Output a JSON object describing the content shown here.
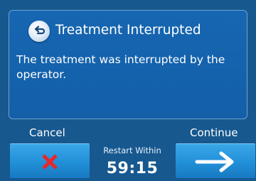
{
  "dialog": {
    "title": "Treatment Interrupted",
    "message": "The treatment was interrupted by the operator.",
    "back_icon": "back-arrow-icon"
  },
  "actions": {
    "cancel_label": "Cancel",
    "cancel_icon": "close-x-icon",
    "continue_label": "Continue",
    "continue_icon": "arrow-right-icon"
  },
  "restart": {
    "label": "Restart Within",
    "countdown": "59:15"
  },
  "colors": {
    "background": "#17588f",
    "dialog": "#1563ad",
    "button": "#2696dd",
    "cancel_icon": "#e8262a",
    "text": "#ffffff"
  }
}
